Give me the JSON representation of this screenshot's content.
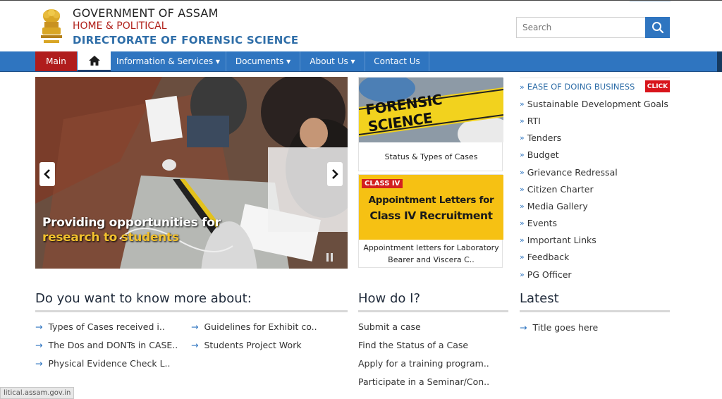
{
  "header": {
    "gov_title": "GOVERNMENT OF ASSAM",
    "dept": "HOME & POLITICAL",
    "directorate": "DIRECTORATE OF FORENSIC SCIENCE",
    "search_placeholder": "Search"
  },
  "nav": {
    "main": "Main",
    "items": [
      "Information & Services ▾",
      "Documents ▾",
      "About Us ▾",
      "Contact Us"
    ]
  },
  "slider": {
    "caption_line1": "Providing opportunities for",
    "caption_line2": "research to students"
  },
  "cards": [
    {
      "image_text": "FORENSIC SCIENCE",
      "caption": "Status & Types of Cases"
    },
    {
      "badge": "CLASS IV",
      "image_line1": "Appointment Letters for",
      "image_line2": "Class IV Recruitment",
      "caption_line1": "Appointment letters for Laboratory",
      "caption_line2": "Bearer and Viscera C.."
    }
  ],
  "quick_links": [
    "EASE OF DOING BUSINESS",
    "Sustainable Development Goals",
    "RTI",
    "Tenders",
    "Budget",
    "Grievance Redressal",
    "Citizen Charter",
    "Media Gallery",
    "Events",
    "Important Links",
    "Feedback",
    "PG Officer"
  ],
  "click_badge": "CLICK",
  "know_more": {
    "title": "Do you want to know more about:",
    "col1": [
      "Types of Cases received i..",
      "The Dos and DONTs in CASE..",
      "Physical Evidence Check L.."
    ],
    "col2": [
      "Guidelines for Exhibit co..",
      "Students Project Work"
    ]
  },
  "how_do_i": {
    "title": "How do I?",
    "items": [
      "Submit a case",
      "Find the Status of a Case",
      "Apply for a training program..",
      "Participate in a Seminar/Con.."
    ]
  },
  "latest": {
    "title": "Latest",
    "item": "Title goes here"
  },
  "status_url": "litical.assam.gov.in",
  "colors": {
    "nav_blue": "#2f75c0",
    "main_red": "#b01c1c",
    "dir_blue": "#2f6ea8",
    "dept_red": "#b0201a"
  },
  "icons": [
    "emblem-icon",
    "search-icon",
    "home-icon",
    "chevron-left-icon",
    "chevron-right-icon",
    "pause-icon",
    "arrow-right-icon"
  ]
}
